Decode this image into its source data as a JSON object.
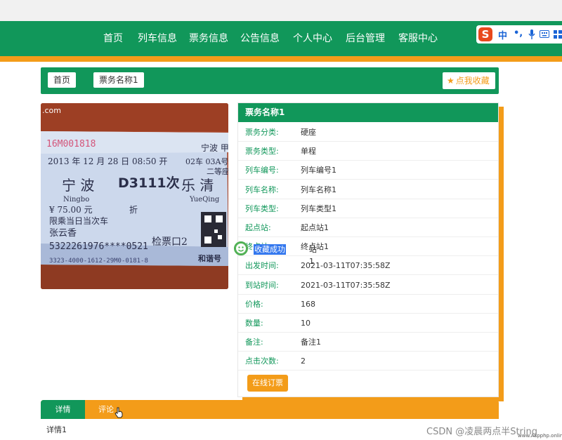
{
  "nav": {
    "items": [
      "首页",
      "列车信息",
      "票务信息",
      "公告信息",
      "个人中心",
      "后台管理",
      "客服中心"
    ]
  },
  "ime": {
    "logo": "S",
    "mode": "中",
    "punct": "•,"
  },
  "breadcrumb": {
    "home": "首页",
    "separator": "/",
    "current": "票务名称1"
  },
  "favorite_button": {
    "label": "点我收藏",
    "icon": "star-icon"
  },
  "photo": {
    "alt": "ticket photo",
    "corner_text": ".com",
    "serial": "16M001818",
    "date_line": "2013 年 12 月 28 日 08:50 开",
    "from": "宁 波",
    "from_pinyin": "Ningbo",
    "train": "D3111次",
    "to": "乐 清",
    "to_pinyin": "YueQing",
    "right_top": "宁波 甲",
    "car_seat": "02车 03A号",
    "seat_class": "二等座",
    "price": "¥ 75.00 元",
    "discount": "折",
    "note": "限乘当日当次车",
    "name": "张云香",
    "id_no": "5322261976****0521",
    "gate": "检票口2",
    "code_line": "3323-4000-1612-29M0-0181-8",
    "bottom_right": "和谐号"
  },
  "detail": {
    "title": "票务名称1",
    "rows": [
      {
        "label": "票务分类:",
        "value": "硬座"
      },
      {
        "label": "票务类型:",
        "value": "单程"
      },
      {
        "label": "列车编号:",
        "value": "列车编号1"
      },
      {
        "label": "列车名称:",
        "value": "列车名称1"
      },
      {
        "label": "列车类型:",
        "value": "列车类型1"
      },
      {
        "label": "起点站:",
        "value": "起点站1"
      },
      {
        "label": "终点站:",
        "value": "终点站1"
      },
      {
        "label": "出发时间:",
        "value": "2021-03-11T07:35:58Z"
      },
      {
        "label": "到站时间:",
        "value": "2021-03-11T07:35:58Z"
      },
      {
        "label": "价格:",
        "value": "168"
      },
      {
        "label": "数量:",
        "value": "10"
      },
      {
        "label": "备注:",
        "value": "备注1"
      },
      {
        "label": "点击次数:",
        "value": "2"
      }
    ],
    "order_button": "在线订票"
  },
  "toast": {
    "message": "收藏成功",
    "tail": "站1",
    "icon": "smile-icon"
  },
  "tabs": {
    "items": [
      "详情",
      "评论"
    ],
    "active": 0,
    "content": "详情1"
  },
  "watermark": {
    "text": "CSDN @凌晨两点半String",
    "site": "www.Aspphp.online"
  },
  "colors": {
    "primary": "#11975a",
    "accent": "#f39c19",
    "toast_bg": "#3377ee"
  }
}
